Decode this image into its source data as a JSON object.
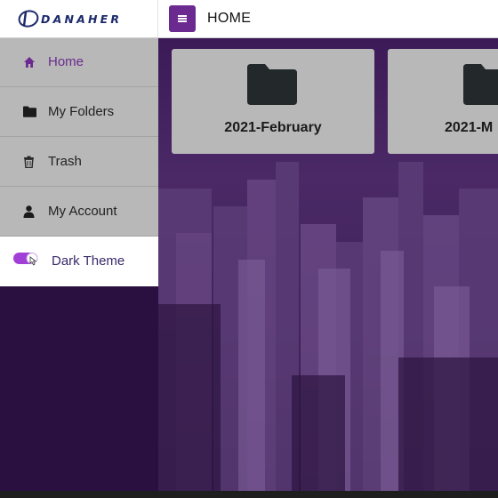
{
  "header": {
    "logo_text": "DANAHER",
    "page_title": "HOME",
    "menu_icon": "hamburger-icon"
  },
  "sidebar": {
    "items": [
      {
        "label": "Home",
        "icon": "home-icon",
        "active": true
      },
      {
        "label": "My Folders",
        "icon": "folder-icon",
        "active": false
      },
      {
        "label": "Trash",
        "icon": "trash-icon",
        "active": false
      },
      {
        "label": "My Account",
        "icon": "user-icon",
        "active": false
      }
    ],
    "theme_toggle": {
      "label": "Dark Theme",
      "icon": "toggle-icon",
      "on": true
    }
  },
  "main": {
    "folders": [
      {
        "name": "2021-February",
        "icon": "folder-icon"
      },
      {
        "name": "2021-M",
        "icon": "folder-icon"
      }
    ]
  },
  "colors": {
    "accent": "#6a2a8f",
    "sidebar_item_bg": "#b8b8b8",
    "background": "#2a1040",
    "logo_text": "#1c2a6b"
  }
}
